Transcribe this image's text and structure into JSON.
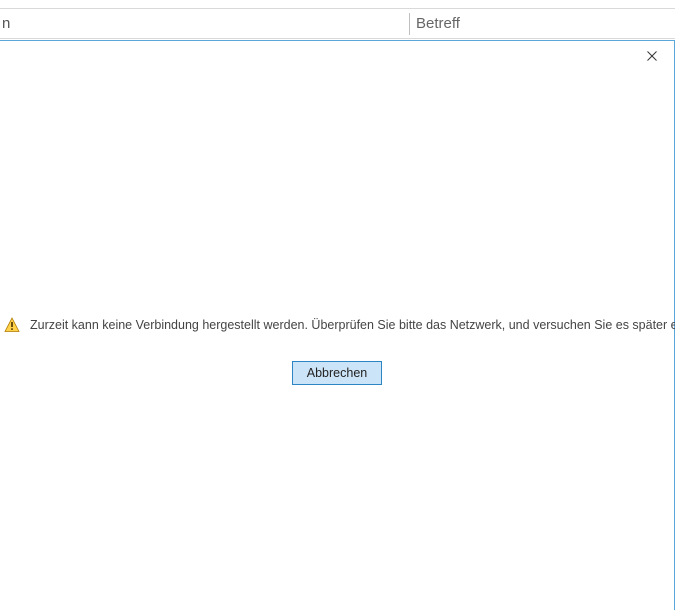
{
  "background": {
    "col1_text": "n",
    "col2_text": "Betreff"
  },
  "dialog": {
    "message": "Zurzeit kann keine Verbindung hergestellt werden. Überprüfen Sie bitte das Netzwerk, und versuchen Sie es später erneut.",
    "cancel_label": "Abbrechen"
  }
}
